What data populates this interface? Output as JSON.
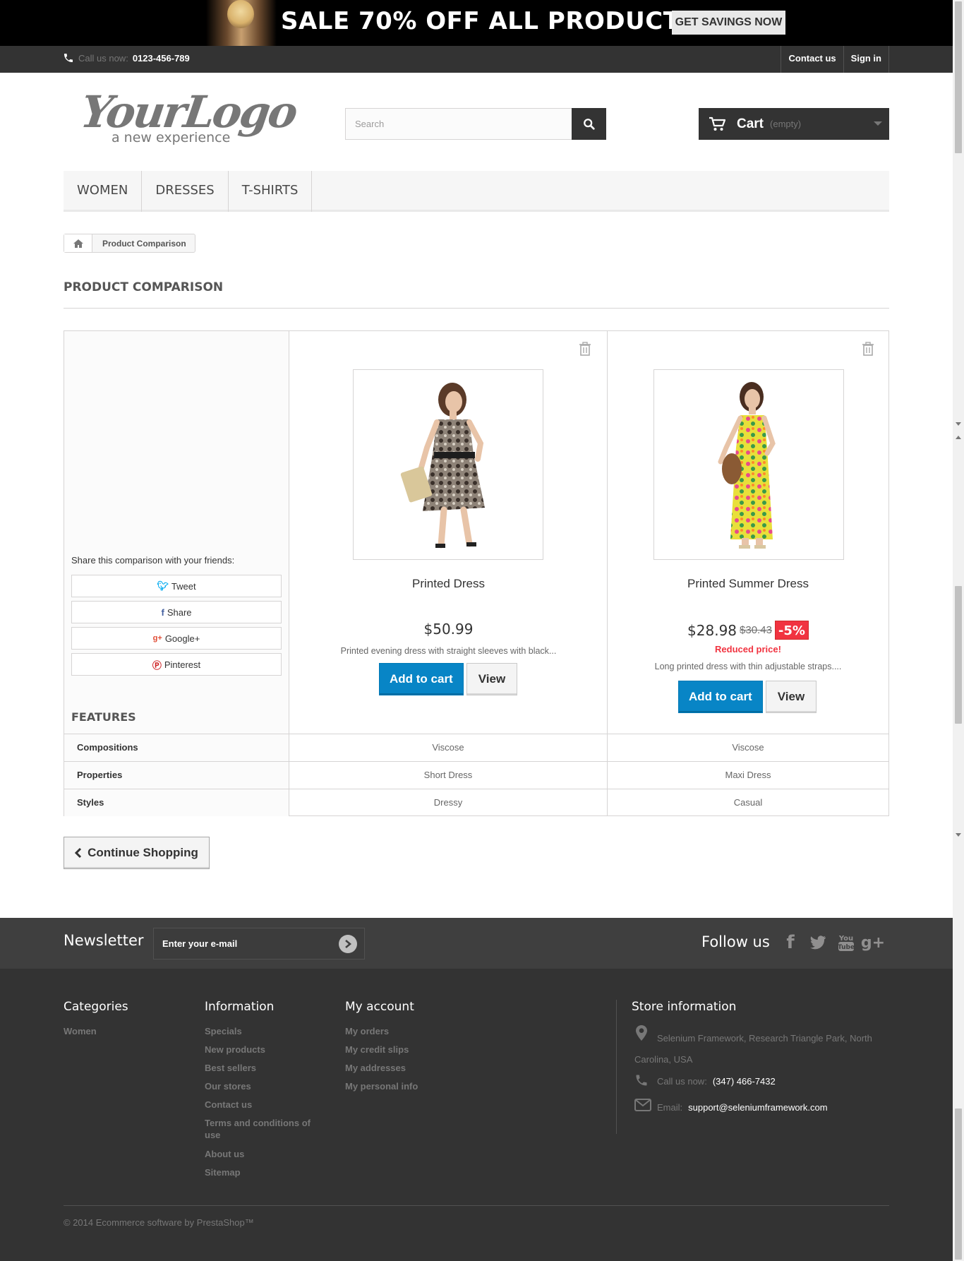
{
  "banner": {
    "sale_text": "SALE 70% OFF ALL PRODUCTS",
    "cta_label": "GET SAVINGS NOW"
  },
  "topnav": {
    "call_label": "Call us now:",
    "phone": "0123-456-789",
    "contact_label": "Contact us",
    "signin_label": "Sign in"
  },
  "header": {
    "logo_main": "YourLogo",
    "logo_sub": "a new experience",
    "search_placeholder": "Search",
    "cart_label": "Cart",
    "cart_status": "(empty)"
  },
  "menu": {
    "items": [
      {
        "label": "WOMEN"
      },
      {
        "label": "DRESSES"
      },
      {
        "label": "T-SHIRTS"
      }
    ]
  },
  "breadcrumb": {
    "current": "Product Comparison"
  },
  "page": {
    "heading": "PRODUCT COMPARISON"
  },
  "share": {
    "label": "Share this comparison with your friends:",
    "buttons": [
      {
        "label": "Tweet",
        "icon": "twitter-icon",
        "color": "#00aaf0"
      },
      {
        "label": "Share",
        "icon": "facebook-icon",
        "color": "#435f9f"
      },
      {
        "label": "Google+",
        "icon": "google-plus-icon",
        "color": "#e04b34"
      },
      {
        "label": "Pinterest",
        "icon": "pinterest-icon",
        "color": "#ce1f21"
      }
    ]
  },
  "features_title": "FEATURES",
  "products": [
    {
      "name": "Printed Dress",
      "price": "$50.99",
      "old_price": "",
      "discount": "",
      "reduced": "",
      "description": "Printed evening dress with straight sleeves with black...",
      "add_label": "Add to cart",
      "view_label": "View"
    },
    {
      "name": "Printed Summer Dress",
      "price": "$28.98",
      "old_price": "$30.43",
      "discount": "-5%",
      "reduced": "Reduced price!",
      "description": "Long printed dress with thin adjustable straps....",
      "add_label": "Add to cart",
      "view_label": "View"
    }
  ],
  "features": [
    {
      "name": "Compositions",
      "values": [
        "Viscose",
        "Viscose"
      ]
    },
    {
      "name": "Properties",
      "values": [
        "Short Dress",
        "Maxi Dress"
      ]
    },
    {
      "name": "Styles",
      "values": [
        "Dressy",
        "Casual"
      ]
    }
  ],
  "continue_label": "Continue Shopping",
  "newsletter": {
    "title": "Newsletter",
    "placeholder": "Enter your e-mail",
    "follow_title": "Follow us"
  },
  "footer": {
    "categories": {
      "title": "Categories",
      "links": [
        "Women"
      ]
    },
    "information": {
      "title": "Information",
      "links": [
        "Specials",
        "New products",
        "Best sellers",
        "Our stores",
        "Contact us",
        "Terms and conditions of use",
        "About us",
        "Sitemap"
      ]
    },
    "account": {
      "title": "My account",
      "links": [
        "My orders",
        "My credit slips",
        "My addresses",
        "My personal info"
      ]
    },
    "store": {
      "title": "Store information",
      "address": "Selenium Framework, Research Triangle Park, North Carolina, USA",
      "call_label": "Call us now:",
      "phone": "(347) 466-7432",
      "email_label": "Email:",
      "email": "support@seleniumframework.com"
    },
    "copyright": "© 2014 Ecommerce software by PrestaShop™"
  },
  "colors": {
    "accent_blue": "#0885c6",
    "discount_red": "#f13340",
    "dark": "#333333"
  }
}
